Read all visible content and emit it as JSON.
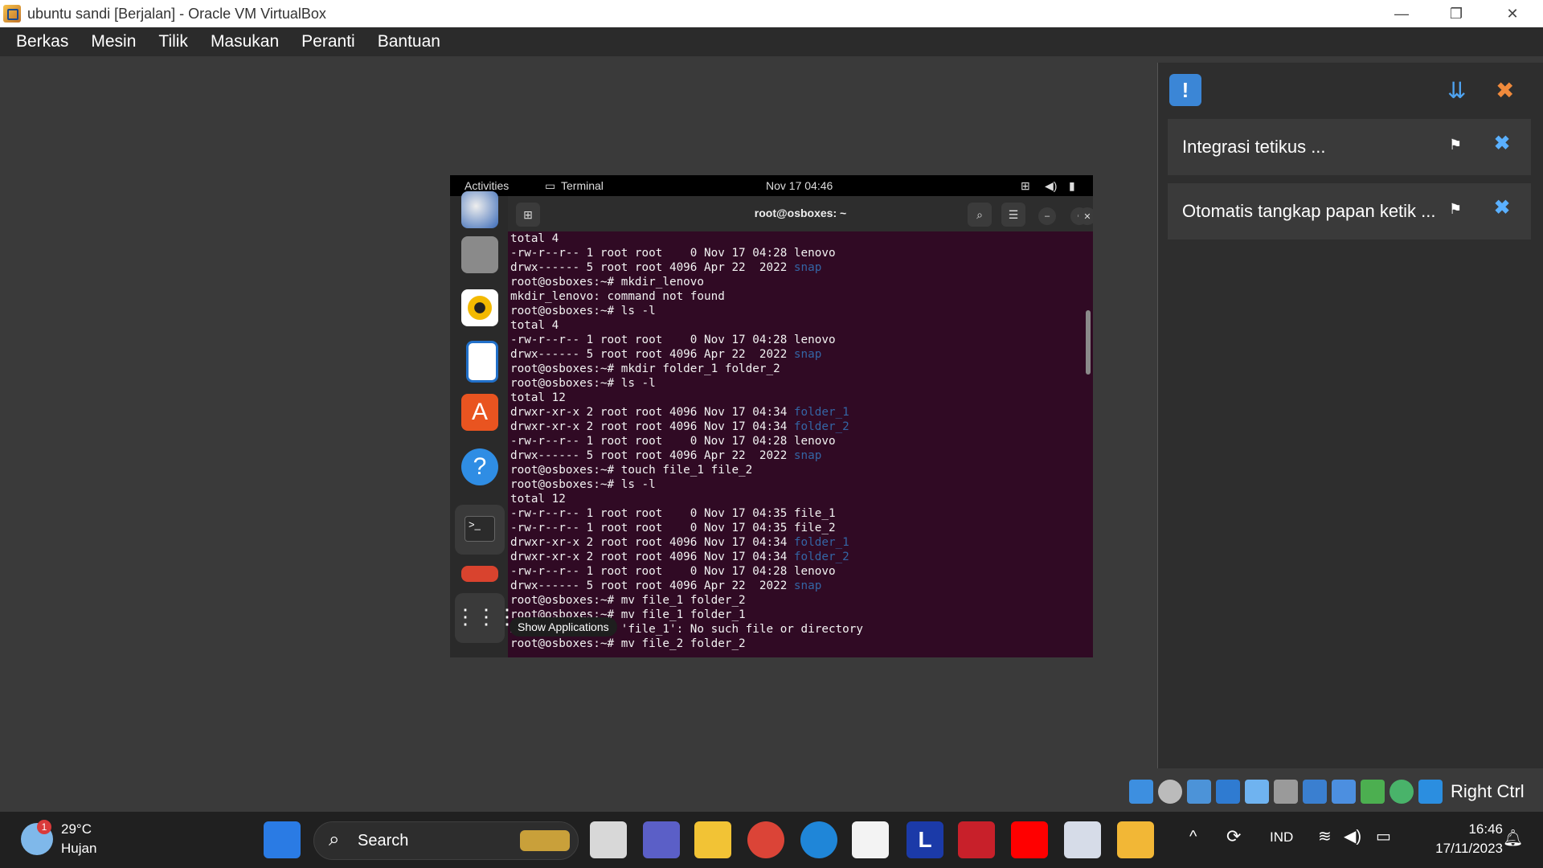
{
  "window": {
    "title": "ubuntu sandi [Berjalan] - Oracle VM VirtualBox",
    "controls": {
      "minimize": "—",
      "restore": "❐",
      "close": "✕"
    }
  },
  "menubar": [
    "Berkas",
    "Mesin",
    "Tilik",
    "Masukan",
    "Peranti",
    "Bantuan"
  ],
  "guest": {
    "topbar": {
      "activities": "Activities",
      "app": "Terminal",
      "clock": "Nov 17  04:46"
    },
    "terminal_title": "root@osboxes: ~",
    "tooltip": "Show Applications",
    "lines": [
      {
        "t": "total 4"
      },
      {
        "t": "-rw-r--r-- 1 root root    0 Nov 17 04:28 lenovo"
      },
      {
        "t": "drwx------ 5 root root 4096 Apr 22  2022 ",
        "b": "snap"
      },
      {
        "t": "root@osboxes:~# mkdir_lenovo"
      },
      {
        "t": "mkdir_lenovo: command not found"
      },
      {
        "t": "root@osboxes:~# ls -l"
      },
      {
        "t": "total 4"
      },
      {
        "t": "-rw-r--r-- 1 root root    0 Nov 17 04:28 lenovo"
      },
      {
        "t": "drwx------ 5 root root 4096 Apr 22  2022 ",
        "b": "snap"
      },
      {
        "t": "root@osboxes:~# mkdir folder_1 folder_2"
      },
      {
        "t": "root@osboxes:~# ls -l"
      },
      {
        "t": "total 12"
      },
      {
        "t": "drwxr-xr-x 2 root root 4096 Nov 17 04:34 ",
        "b": "folder_1"
      },
      {
        "t": "drwxr-xr-x 2 root root 4096 Nov 17 04:34 ",
        "b": "folder_2"
      },
      {
        "t": "-rw-r--r-- 1 root root    0 Nov 17 04:28 lenovo"
      },
      {
        "t": "drwx------ 5 root root 4096 Apr 22  2022 ",
        "b": "snap"
      },
      {
        "t": "root@osboxes:~# touch file_1 file_2"
      },
      {
        "t": "root@osboxes:~# ls -l"
      },
      {
        "t": "total 12"
      },
      {
        "t": "-rw-r--r-- 1 root root    0 Nov 17 04:35 file_1"
      },
      {
        "t": "-rw-r--r-- 1 root root    0 Nov 17 04:35 file_2"
      },
      {
        "t": "drwxr-xr-x 2 root root 4096 Nov 17 04:34 ",
        "b": "folder_1"
      },
      {
        "t": "drwxr-xr-x 2 root root 4096 Nov 17 04:34 ",
        "b": "folder_2"
      },
      {
        "t": "-rw-r--r-- 1 root root    0 Nov 17 04:28 lenovo"
      },
      {
        "t": "drwx------ 5 root root 4096 Apr 22  2022 ",
        "b": "snap"
      },
      {
        "t": "root@osboxes:~# mv file_1 folder_2"
      },
      {
        "t": "root@osboxes:~# mv file_1 folder_1"
      },
      {
        "t": "mv: cannot stat 'file_1': No such file or directory"
      },
      {
        "t": "root@osboxes:~# mv file_2 folder_2"
      }
    ]
  },
  "notifications": [
    {
      "text": "Integrasi tetikus ..."
    },
    {
      "text": "Otomatis tangkap papan ketik ..."
    }
  ],
  "status_key": "Right Ctrl",
  "taskbar": {
    "weather": {
      "temp": "29°C",
      "desc": "Hujan",
      "badge": "1"
    },
    "search": "Search",
    "lang": "IND",
    "time": "16:46",
    "date": "17/11/2023"
  },
  "colors": {
    "terminal_bg": "#300a24",
    "dir_blue": "#3465a4",
    "accent": "#5ab0ff"
  }
}
